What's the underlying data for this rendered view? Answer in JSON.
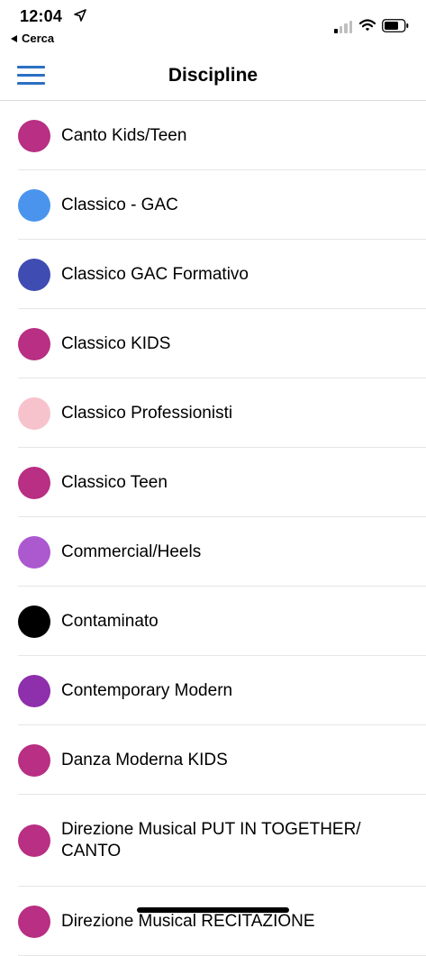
{
  "status_bar": {
    "time": "12:04",
    "back_label": "Cerca",
    "icons": [
      "location-arrow-icon",
      "cellular-signal-icon",
      "wifi-icon",
      "battery-icon"
    ]
  },
  "nav": {
    "title": "Discipline",
    "menu_icon": "hamburger-menu-icon",
    "accent_color": "#2b6fc2"
  },
  "disciplines": [
    {
      "label": "Canto Kids/Teen",
      "color": "#b82f83"
    },
    {
      "label": "Classico - GAC",
      "color": "#4a94ee"
    },
    {
      "label": "Classico GAC Formativo",
      "color": "#3f4db3"
    },
    {
      "label": "Classico KIDS",
      "color": "#b82f83"
    },
    {
      "label": "Classico Professionisti",
      "color": "#f6c3cc"
    },
    {
      "label": "Classico Teen",
      "color": "#b82f83"
    },
    {
      "label": "Commercial/Heels",
      "color": "#ac59d0"
    },
    {
      "label": "Contaminato",
      "color": "#000000"
    },
    {
      "label": "Contemporary Modern",
      "color": "#8e2fac"
    },
    {
      "label": "Danza Moderna KIDS",
      "color": "#b82f83"
    },
    {
      "label": "Direzione Musical PUT IN TOGETHER/ CANTO",
      "color": "#b82f83"
    },
    {
      "label": "Direzione Musical RECITAZIONE",
      "color": "#b82f83"
    }
  ]
}
